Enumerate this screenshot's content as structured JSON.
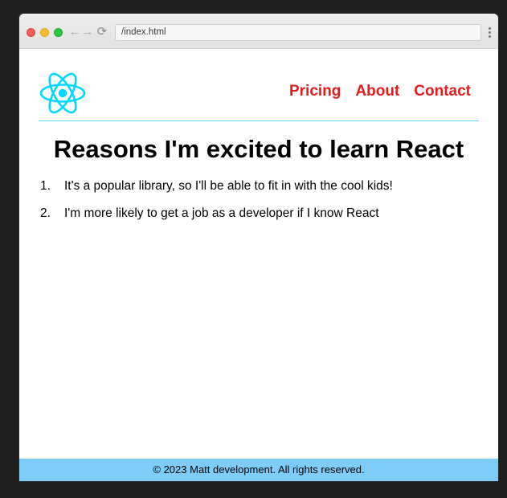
{
  "browser": {
    "url": "/index.html",
    "back_glyph": "←",
    "forward_glyph": "→",
    "reload_glyph": "⟳"
  },
  "header": {
    "logo_icon": "react-logo-icon",
    "nav": [
      {
        "label": "Pricing"
      },
      {
        "label": "About"
      },
      {
        "label": "Contact"
      }
    ]
  },
  "main": {
    "title": "Reasons I'm excited to learn React",
    "items": [
      {
        "num": "1.",
        "text": "It's a popular library, so I'll be able to fit in with the cool kids!"
      },
      {
        "num": "2.",
        "text": "I'm more likely to get a job as a developer if I know React"
      }
    ]
  },
  "footer": {
    "text": "© 2023 Matt development. All rights reserved."
  },
  "colors": {
    "accent": "#61dafb",
    "nav_link": "#e21d1d",
    "footer_bg": "#7dcdf8"
  }
}
